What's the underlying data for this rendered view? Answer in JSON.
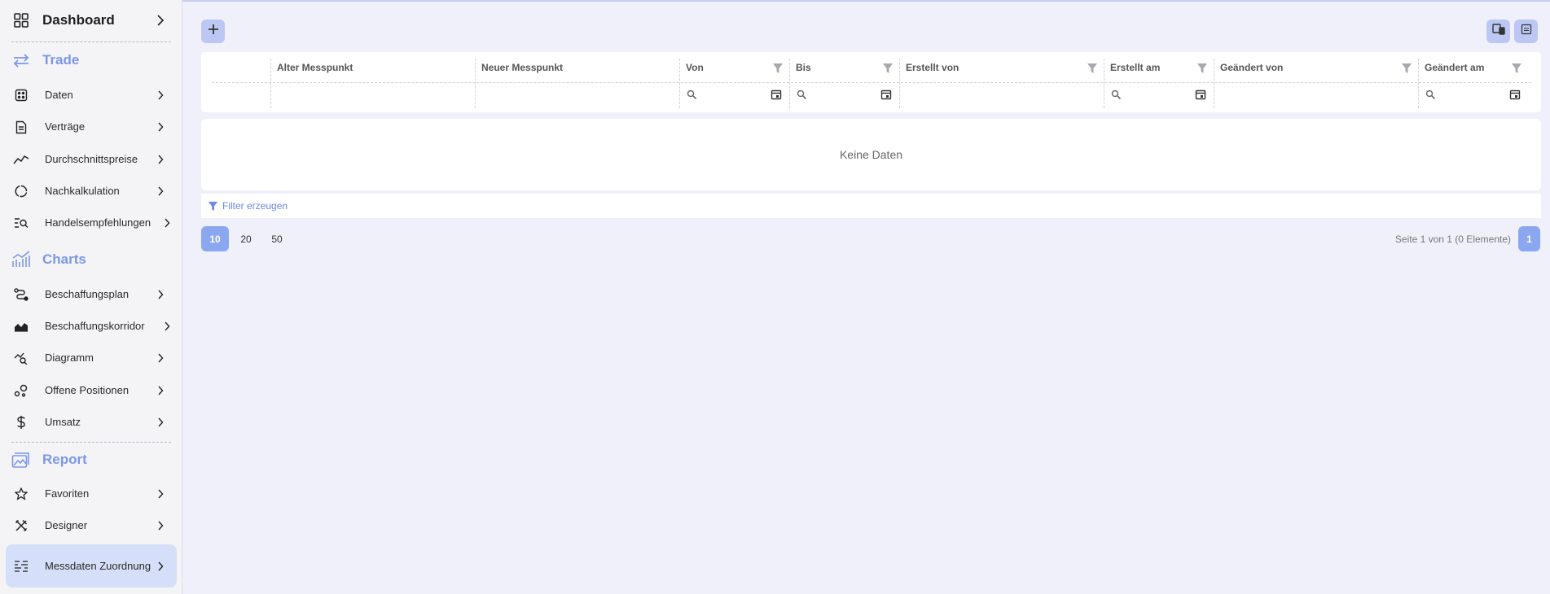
{
  "sidebar": {
    "dashboard": "Dashboard",
    "sections": {
      "trade": "Trade",
      "charts": "Charts",
      "report": "Report"
    },
    "trade_items": [
      "Daten",
      "Verträge",
      "Durchschnittspreise",
      "Nachkalkulation",
      "Handelsempfehlungen"
    ],
    "charts_items": [
      "Beschaffungsplan",
      "Beschaffungskorridor",
      "Diagramm",
      "Offene Positionen",
      "Umsatz"
    ],
    "report_items": [
      "Favoriten",
      "Designer"
    ],
    "active_item": "Messdaten Zuordnung"
  },
  "grid": {
    "columns": [
      "Alter Messpunkt",
      "Neuer Messpunkt",
      "Von",
      "Bis",
      "Erstellt von",
      "Erstellt am",
      "Geändert von",
      "Geändert am"
    ],
    "no_data": "Keine Daten",
    "filter_label": "Filter erzeugen"
  },
  "pager": {
    "sizes": [
      "10",
      "20",
      "50"
    ],
    "selected_size": "10",
    "info": "Seite 1 von 1 (0 Elemente)",
    "current_page": "1"
  },
  "colors": {
    "accent": "#7b98e8",
    "active_bg": "#d6dff9",
    "pager_active": "#8aa7f0"
  }
}
